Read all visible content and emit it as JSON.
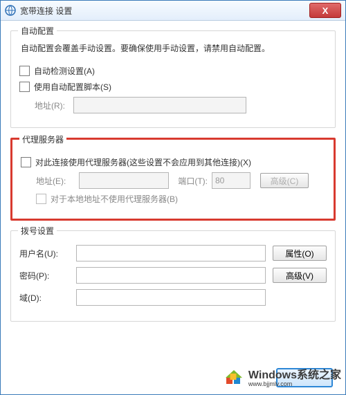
{
  "window": {
    "title": "宽带连接 设置",
    "close_icon": "X"
  },
  "auto_config": {
    "caption": "自动配置",
    "description": "自动配置会覆盖手动设置。要确保使用手动设置，请禁用自动配置。",
    "auto_detect_label": "自动检测设置(A)",
    "use_script_label": "使用自动配置脚本(S)",
    "address_label": "地址(R):",
    "address_value": ""
  },
  "proxy": {
    "caption": "代理服务器",
    "use_proxy_label": "对此连接使用代理服务器(这些设置不会应用到其他连接)(X)",
    "address_label": "地址(E):",
    "address_value": "",
    "port_label": "端口(T):",
    "port_value": "80",
    "advanced_btn": "高级(C)",
    "bypass_local_label": "对于本地地址不使用代理服务器(B)"
  },
  "dialup": {
    "caption": "拨号设置",
    "username_label": "用户名(U):",
    "username_value": "",
    "password_label": "密码(P):",
    "password_value": "",
    "domain_label": "域(D):",
    "domain_value": "",
    "properties_btn": "属性(O)",
    "advanced_btn": "高级(V)"
  },
  "footer": {},
  "watermark": {
    "line1": "Windows系统之家",
    "line2": "www.bjjmlv.com"
  }
}
